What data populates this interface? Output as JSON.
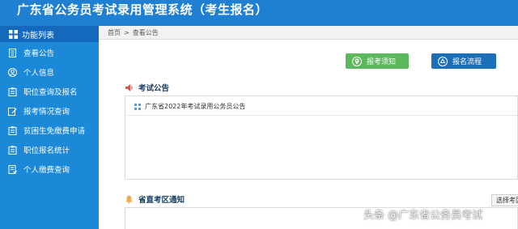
{
  "header": {
    "title": "广东省公务员考试录用管理系统（考生报名）"
  },
  "sidebar": {
    "heading": "功能列表",
    "items": [
      {
        "label": "查看公告",
        "icon": "document-icon"
      },
      {
        "label": "个人信息",
        "icon": "user-icon"
      },
      {
        "label": "职位查询及报名",
        "icon": "clipboard-icon"
      },
      {
        "label": "报考情况查询",
        "icon": "edit-icon"
      },
      {
        "label": "贫困生免缴费申请",
        "icon": "clipboard-icon"
      },
      {
        "label": "职位报名统计",
        "icon": "clipboard-icon"
      },
      {
        "label": "个人缴费查询",
        "icon": "list-icon"
      }
    ]
  },
  "breadcrumb": {
    "home": "首页",
    "separator": ">",
    "current": "查看公告"
  },
  "buttons": {
    "exam_notice": "报考须知",
    "registration_flow": "报名流程"
  },
  "announcements": {
    "title": "考试公告",
    "items": [
      "广东省2022年考试录用公务员公告"
    ]
  },
  "exam_area": {
    "title": "省直考区通知",
    "select_button": "选择考区"
  },
  "watermark": "头条 @广东省公务员考试",
  "colors": {
    "header": "#1f7fd3",
    "sidebar": "#1b88d8",
    "sidebar_heading": "#1569bd",
    "green_button": "#5cb85c",
    "blue_button": "#1b6fb8",
    "speaker": "#d9534f",
    "bell": "#f0ad4e"
  }
}
